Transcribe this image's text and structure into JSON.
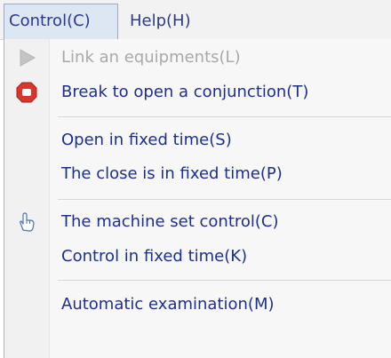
{
  "menubar": {
    "items": [
      {
        "label": "Control(C)"
      },
      {
        "label": "Help(H)"
      }
    ]
  },
  "menu": {
    "items": [
      {
        "label": "Link an equipments(L)",
        "icon": "play-icon",
        "enabled": false
      },
      {
        "label": "Break to open a conjunction(T)",
        "icon": "stop-octagon-icon",
        "enabled": true
      },
      {
        "label": "Open in fixed time(S)",
        "icon": "",
        "enabled": true
      },
      {
        "label": "The close is in fixed time(P)",
        "icon": "",
        "enabled": true
      },
      {
        "label": "The machine set control(C)",
        "icon": "hand-pointer-icon",
        "enabled": true
      },
      {
        "label": "Control in fixed time(K)",
        "icon": "",
        "enabled": true
      },
      {
        "label": "Automatic examination(M)",
        "icon": "",
        "enabled": true
      }
    ]
  },
  "colors": {
    "menu_text": "#1d2f8f",
    "disabled_text": "#a9a9a9",
    "active_menu_bg": "#dde7f4",
    "stop_icon_red": "#d9372c"
  }
}
